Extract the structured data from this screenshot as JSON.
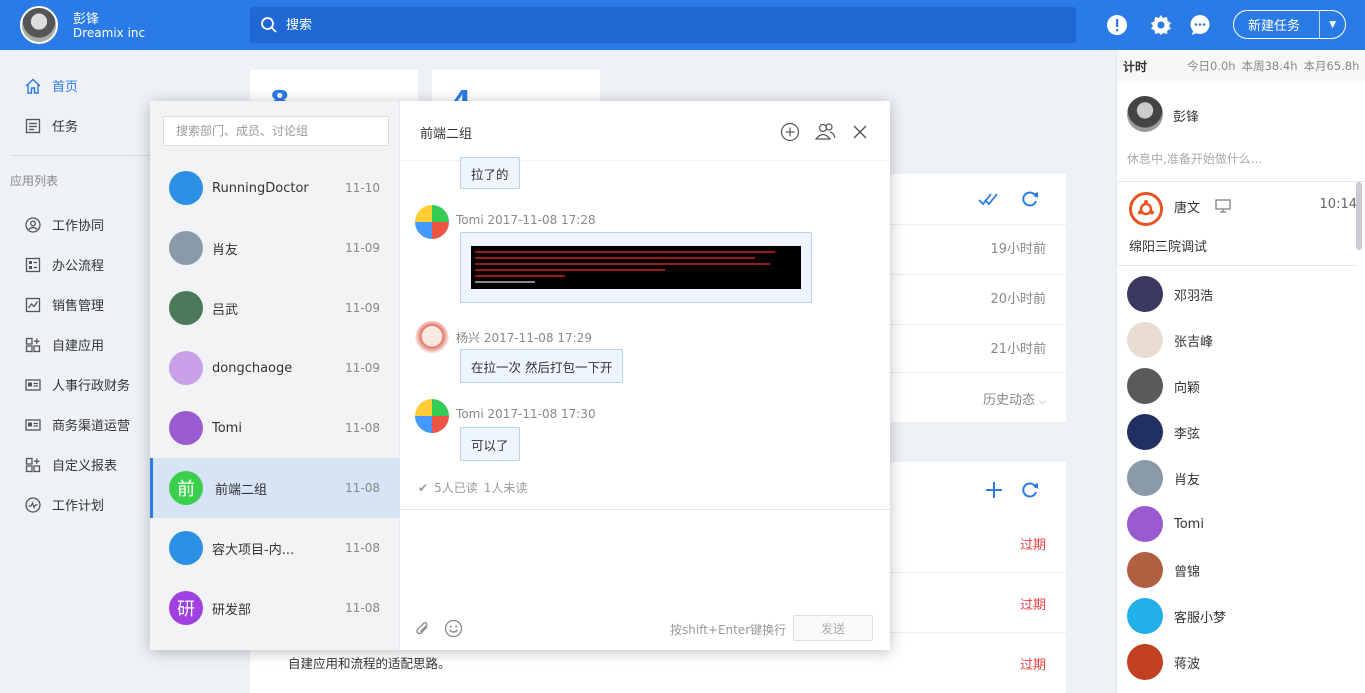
{
  "header": {
    "user_name": "彭锋",
    "org": "Dreamix inc",
    "search_placeholder": "搜索",
    "new_task_label": "新建任务"
  },
  "sidebar": {
    "home": "首页",
    "tasks": "任务",
    "section_title": "应用列表",
    "apps": [
      "工作协同",
      "办公流程",
      "销售管理",
      "自建应用",
      "人事行政财务",
      "商务渠道运营",
      "自定义报表",
      "工作计划"
    ]
  },
  "main": {
    "stat1": "8",
    "stat2": "4",
    "activity_times": [
      "19小时前",
      "20小时前",
      "21小时前"
    ],
    "history_label": "历史动态",
    "overdue": [
      "过期",
      "过期",
      "过期"
    ],
    "task_text": "自建应用和流程的适配思路。"
  },
  "chat": {
    "search_placeholder": "搜索部门、成员、讨论组",
    "conversations": [
      {
        "name": "RunningDoctor",
        "date": "11-10",
        "avatar_text": "",
        "color": "#2b8fe6"
      },
      {
        "name": "肖友",
        "date": "11-09",
        "avatar_text": "",
        "color": "#8a9aa8"
      },
      {
        "name": "吕武",
        "date": "11-09",
        "avatar_text": "",
        "color": "#4a7a5a"
      },
      {
        "name": "dongchaoge",
        "date": "11-09",
        "avatar_text": "",
        "color": "#c8a0e8"
      },
      {
        "name": "Tomi",
        "date": "11-08",
        "avatar_text": "",
        "color": "#9a5ad0"
      },
      {
        "name": "前端二组",
        "date": "11-08",
        "avatar_text": "前",
        "color": "#3ccf4e"
      },
      {
        "name": "容大项目-内...",
        "date": "11-08",
        "avatar_text": "",
        "color": "#2b8fe6"
      },
      {
        "name": "研发部",
        "date": "11-08",
        "avatar_text": "研",
        "color": "#a040e0"
      }
    ],
    "title": "前端二组",
    "messages": [
      {
        "text": "拉了的"
      },
      {
        "meta": "Tomi 2017-11-08 17:28"
      },
      {
        "meta": "杨兴 2017-11-08 17:29",
        "text": "在拉一次 然后打包一下开"
      },
      {
        "meta": "Tomi 2017-11-08 17:30",
        "text": "可以了"
      }
    ],
    "read": "5人已读",
    "unread": "1人未读",
    "hint": "按shift+Enter键换行",
    "send": "发送"
  },
  "right_panel": {
    "title": "计时",
    "today": "今日0.0h",
    "week": "本周38.4h",
    "month": "本月65.8h",
    "me_name": "彭锋",
    "me_status": "休息中,准备开始做什么...",
    "highlight": {
      "name": "唐文",
      "time": "10:14",
      "task": "绵阳三院调试"
    },
    "members": [
      {
        "name": "邓羽浩",
        "color": "#3a3a60"
      },
      {
        "name": "张吉峰",
        "color": "#e8ddd0"
      },
      {
        "name": "向颖",
        "color": "#5a5a5a"
      },
      {
        "name": "李弦",
        "color": "#203060"
      },
      {
        "name": "肖友",
        "color": "#8a9aa8"
      },
      {
        "name": "Tomi",
        "color": "#9a5ad0"
      },
      {
        "name": "曾锦",
        "color": "#b06040"
      },
      {
        "name": "客服小梦",
        "color": "#22b0e8"
      },
      {
        "name": "蒋波",
        "color": "#c04020"
      }
    ]
  }
}
